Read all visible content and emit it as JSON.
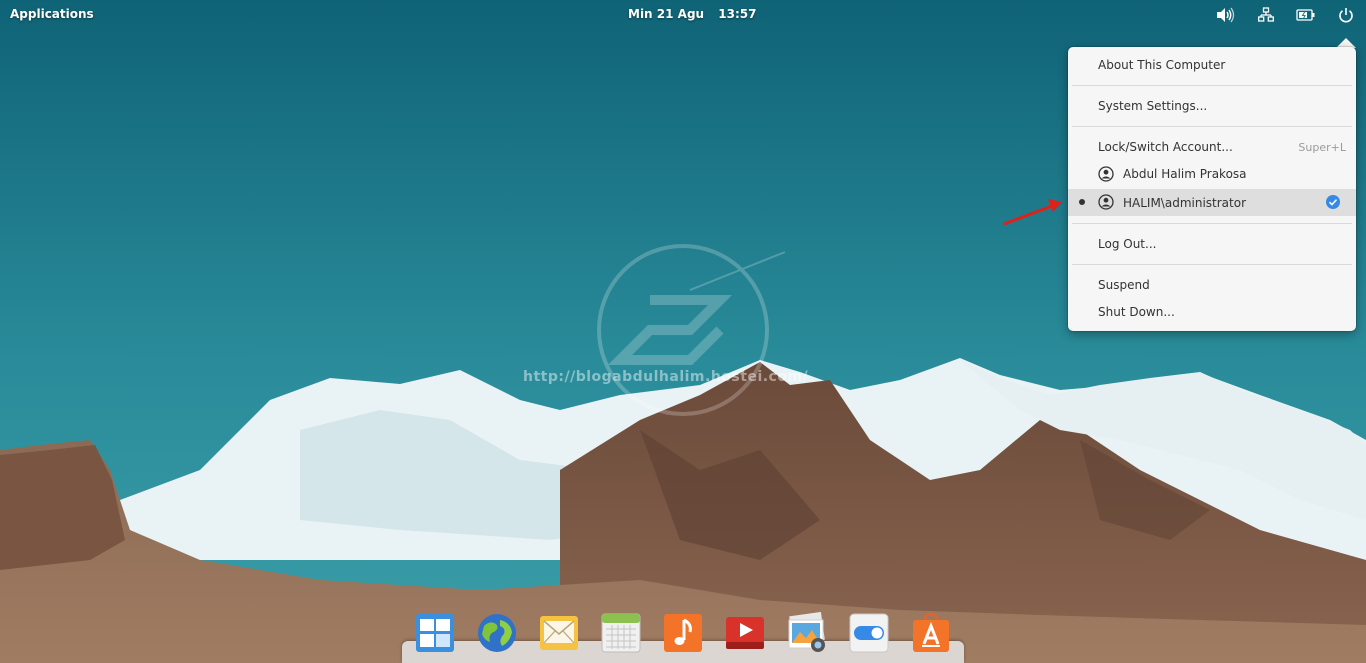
{
  "panel": {
    "applications_label": "Applications",
    "date": "Min 21 Agu",
    "time": "13:57",
    "indicators": [
      "volume-icon",
      "network-icon",
      "battery-icon",
      "power-icon"
    ]
  },
  "session_menu": {
    "about": "About This Computer",
    "settings": "System Settings...",
    "lock": "Lock/Switch Account...",
    "lock_accel": "Super+L",
    "users": [
      {
        "name": "Abdul Halim Prakosa",
        "active": false
      },
      {
        "name": "HALIM\\administrator",
        "active": true
      }
    ],
    "logout": "Log Out...",
    "suspend": "Suspend",
    "shutdown": "Shut Down..."
  },
  "watermark": {
    "url": "http://blogabdulhalim.hostei.com/"
  },
  "dock": {
    "apps": [
      "multitasking-view-icon",
      "web-browser-icon",
      "mail-icon",
      "calendar-icon",
      "music-icon",
      "videos-icon",
      "photos-icon",
      "system-settings-icon",
      "app-center-icon"
    ]
  },
  "colors": {
    "sky_top": "#126a7d",
    "sky_bottom": "#2f8f9c",
    "menu_bg": "#f6f6f6",
    "accent_check": "#3689e6",
    "annotation_arrow": "#e0201b"
  }
}
